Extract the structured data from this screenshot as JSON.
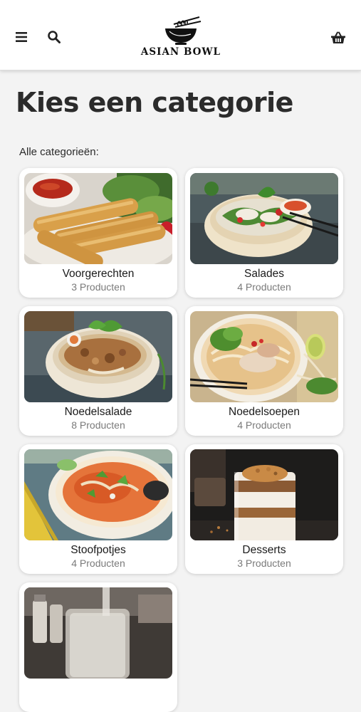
{
  "header": {
    "logo_text": "ASIAN BOWL",
    "icons": {
      "menu": "hamburger-icon",
      "search": "search-icon",
      "cart": "basket-icon"
    }
  },
  "page": {
    "title": "Kies een categorie",
    "section_label": "Alle categorieën:"
  },
  "categories": [
    {
      "name": "Voorgerechten",
      "count": "3 Producten",
      "image": "spring-rolls"
    },
    {
      "name": "Salades",
      "count": "4 Producten",
      "image": "salad-bowl"
    },
    {
      "name": "Noedelsalade",
      "count": "8 Producten",
      "image": "noodle-salad-bowl"
    },
    {
      "name": "Noedelsoepen",
      "count": "4 Producten",
      "image": "noodle-soup-bowl"
    },
    {
      "name": "Stoofpotjes",
      "count": "4 Producten",
      "image": "stew-bowl"
    },
    {
      "name": "Desserts",
      "count": "3 Producten",
      "image": "dessert-glass"
    },
    {
      "name": "",
      "count": "",
      "image": "drinks"
    }
  ],
  "colors": {
    "background": "#f3f3f3",
    "card": "#ffffff",
    "text_muted": "#7a7a7a"
  }
}
